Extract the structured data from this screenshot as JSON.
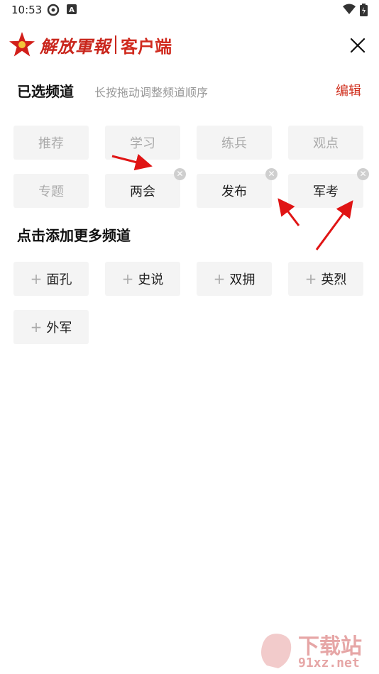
{
  "status_bar": {
    "time": "10:53"
  },
  "header": {
    "logo_calligraphy": "解放軍報",
    "logo_text": "客户端"
  },
  "selected_section": {
    "title": "已选频道",
    "hint": "长按拖动调整频道顺序",
    "edit_label": "编辑",
    "channels": [
      "推荐",
      "学习",
      "练兵",
      "观点",
      "专题",
      "两会",
      "发布",
      "军考"
    ]
  },
  "add_section": {
    "title": "点击添加更多频道",
    "channels": [
      "面孔",
      "史说",
      "双拥",
      "英烈",
      "外军"
    ]
  },
  "watermark": {
    "text1": "下载站",
    "text2": "91xz.net"
  },
  "colors": {
    "accent": "#d0301f",
    "chip_bg": "#f4f4f4",
    "muted": "#aaaaaa"
  }
}
